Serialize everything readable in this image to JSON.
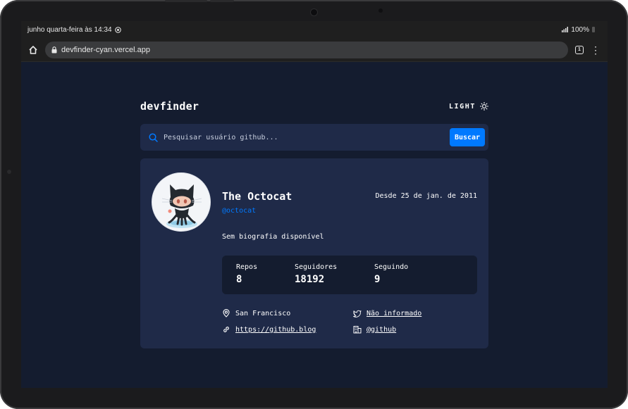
{
  "status_bar": {
    "datetime": "junho quarta-feira às 14:34",
    "battery": "100%"
  },
  "browser": {
    "url": "devfinder-cyan.vercel.app",
    "tab_count": "1"
  },
  "app": {
    "logo": "devfinder",
    "theme_toggle_label": "LIGHT",
    "search": {
      "placeholder": "Pesquisar usuário github...",
      "button_label": "Buscar"
    },
    "profile": {
      "name": "The Octocat",
      "login": "@octocat",
      "joined": "Desde 25 de jan. de 2011",
      "bio": "Sem biografia disponível",
      "stats": [
        {
          "label": "Repos",
          "value": "8"
        },
        {
          "label": "Seguidores",
          "value": "18192"
        },
        {
          "label": "Seguindo",
          "value": "9"
        }
      ],
      "location": "San Francisco",
      "twitter": "Não informado",
      "blog": "https://github.blog",
      "company": "@github"
    }
  },
  "colors": {
    "background": "#141c2f",
    "card": "#1f2a48",
    "accent": "#0079ff"
  }
}
